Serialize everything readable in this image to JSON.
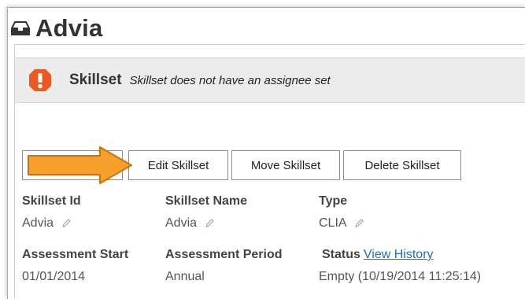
{
  "page": {
    "title": "Advia"
  },
  "alert": {
    "title": "Skillset",
    "message": "Skillset does not have an assignee set"
  },
  "toolbar": {
    "edit_label": "Edit Skillset",
    "move_label": "Move Skillset",
    "delete_label": "Delete Skillset"
  },
  "details": {
    "skillset_id": {
      "label": "Skillset Id",
      "value": "Advia"
    },
    "skillset_name": {
      "label": "Skillset Name",
      "value": "Advia"
    },
    "type": {
      "label": "Type",
      "value": "CLIA"
    },
    "assessment_start": {
      "label": "Assessment Start",
      "value": "01/01/2014"
    },
    "assessment_period": {
      "label": "Assessment Period",
      "value": "Annual"
    },
    "status": {
      "label": "Status",
      "link": "View History",
      "value": "Empty (10/19/2014 11:25:14)"
    }
  },
  "colors": {
    "alert_orange": "#ea5a23",
    "callout_arrow": "#f4a02a",
    "link_blue": "#1a6fc9"
  },
  "icons": {
    "title": "inbox-tray-icon",
    "alert": "exclamation-icon",
    "edit": "pencil-icon"
  }
}
